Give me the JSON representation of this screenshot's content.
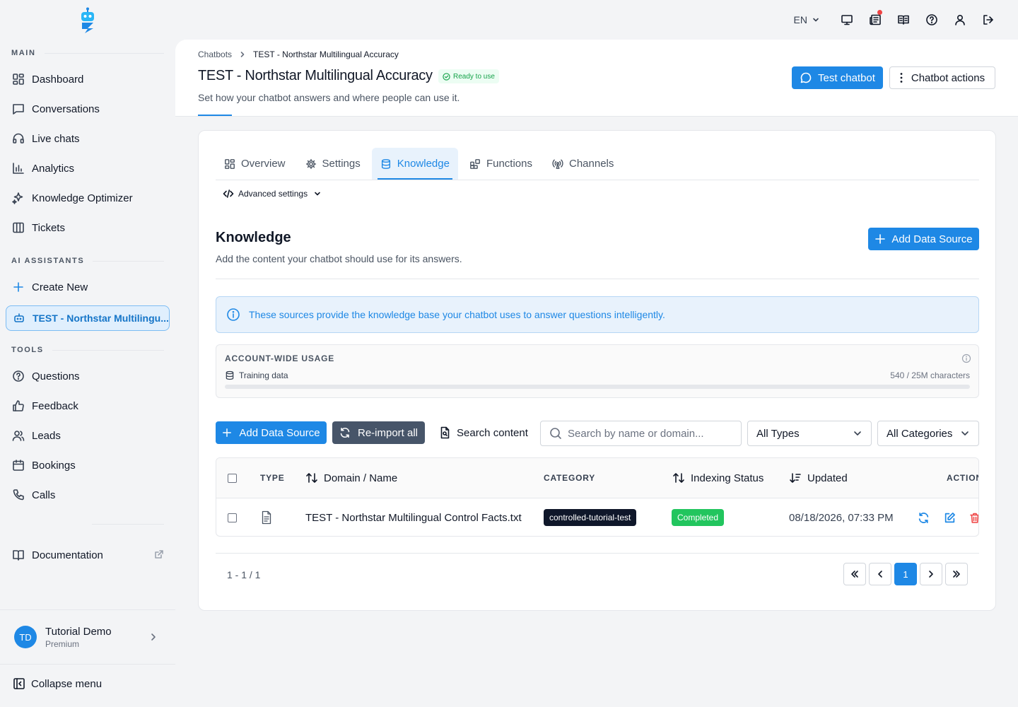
{
  "sidebar": {
    "sections": {
      "main": "MAIN",
      "ai": "AI ASSISTANTS",
      "tools": "TOOLS"
    },
    "main_items": [
      {
        "label": "Dashboard",
        "icon": "dashboard-icon"
      },
      {
        "label": "Conversations",
        "icon": "chat-icon"
      },
      {
        "label": "Live chats",
        "icon": "headset-icon"
      },
      {
        "label": "Analytics",
        "icon": "bar-chart-icon"
      },
      {
        "label": "Knowledge Optimizer",
        "icon": "sparkles-icon"
      },
      {
        "label": "Tickets",
        "icon": "columns-icon"
      }
    ],
    "ai_items": [
      {
        "label": "Create New",
        "icon": "plus-icon"
      },
      {
        "label": "TEST - Northstar Multilingu...",
        "icon": "bot-icon",
        "active": true
      }
    ],
    "tools_items": [
      {
        "label": "Questions",
        "icon": "question-icon"
      },
      {
        "label": "Feedback",
        "icon": "thumbs-up-icon"
      },
      {
        "label": "Leads",
        "icon": "users-icon"
      },
      {
        "label": "Bookings",
        "icon": "calendar-icon"
      },
      {
        "label": "Calls",
        "icon": "phone-icon"
      }
    ],
    "documentation": "Documentation",
    "user": {
      "initials": "TD",
      "name": "Tutorial Demo",
      "plan": "Premium"
    },
    "collapse": "Collapse menu"
  },
  "topbar": {
    "language": "EN",
    "notification_dot_color": "#ef4444"
  },
  "header": {
    "breadcrumb": [
      "Chatbots",
      "TEST - Northstar Multilingual Accuracy"
    ],
    "title": "TEST - Northstar Multilingual Accuracy",
    "status": "Ready to use",
    "subtitle": "Set how your chatbot answers and where people can use it.",
    "test_button": "Test chatbot",
    "actions_button": "Chatbot actions"
  },
  "tabs": [
    {
      "label": "Overview",
      "icon": "dashboard-icon"
    },
    {
      "label": "Settings",
      "icon": "gear-icon"
    },
    {
      "label": "Knowledge",
      "icon": "database-icon",
      "active": true
    },
    {
      "label": "Functions",
      "icon": "puzzle-icon"
    },
    {
      "label": "Channels",
      "icon": "broadcast-icon"
    }
  ],
  "advanced_settings": "Advanced settings",
  "knowledge": {
    "title": "Knowledge",
    "subtitle": "Add the content your chatbot should use for its answers.",
    "add_button": "Add Data Source",
    "info": "These sources provide the knowledge base your chatbot uses to answer questions intelligently.",
    "usage": {
      "label": "ACCOUNT-WIDE USAGE",
      "row_label": "Training data",
      "count": "540 / 25M characters",
      "fraction_used": 2.16e-05
    }
  },
  "toolbar": {
    "add_button": "Add Data Source",
    "reimport_button": "Re-import all",
    "search_content_button": "Search content",
    "search_placeholder": "Search by name or domain...",
    "type_filter": "All Types",
    "category_filter": "All Categories"
  },
  "table": {
    "headers": {
      "type": "TYPE",
      "name": "Domain / Name",
      "category": "CATEGORY",
      "status": "Indexing Status",
      "updated": "Updated",
      "action": "ACTION"
    },
    "rows": [
      {
        "type_icon": "file-text-icon",
        "name": "TEST - Northstar Multilingual Control Facts.txt",
        "category": "controlled-tutorial-test",
        "status": "Completed",
        "updated": "08/18/2026, 07:33 PM"
      }
    ]
  },
  "pagination": {
    "range": "1 - 1 / 1",
    "current_page": "1"
  },
  "colors": {
    "accent": "#1e88e5",
    "success": "#22c55e",
    "danger": "#ef4444",
    "dark_badge": "#0f172a"
  }
}
